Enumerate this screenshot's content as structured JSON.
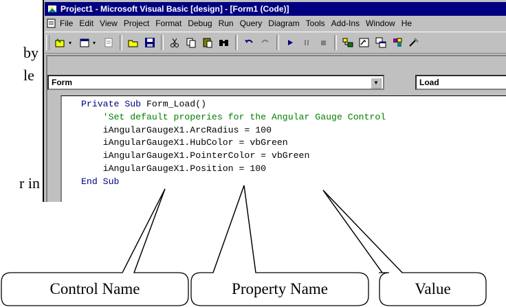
{
  "side_text": {
    "line1": "by",
    "line2": "le",
    "line3": "r in"
  },
  "window": {
    "title": "Project1 - Microsoft Visual Basic [design] - [Form1 (Code)]",
    "menu": [
      "File",
      "Edit",
      "View",
      "Project",
      "Format",
      "Debug",
      "Run",
      "Query",
      "Diagram",
      "Tools",
      "Add-Ins",
      "Window",
      "He"
    ],
    "object_combo": "Form",
    "procedure_combo": "Load"
  },
  "code": {
    "line1_kw1": "Private",
    "line1_kw2": "Sub",
    "line1_rest": " Form_Load()",
    "line2": "'Set default properies for the Angular Gauge Control",
    "line3": "iAngularGaugeX1.ArcRadius = 100",
    "line4": "iAngularGaugeX1.HubColor = vbGreen",
    "line5": "iAngularGaugeX1.PointerColor = vbGreen",
    "line6": "iAngularGaugeX1.Position = 100",
    "line7_kw": "End Sub"
  },
  "callouts": {
    "control_name": "Control Name",
    "property_name": "Property Name",
    "value": "Value"
  },
  "colors": {
    "title_bar": "#000080",
    "keyword": "#000080",
    "comment": "#008000",
    "chrome": "#c0c0c0"
  }
}
